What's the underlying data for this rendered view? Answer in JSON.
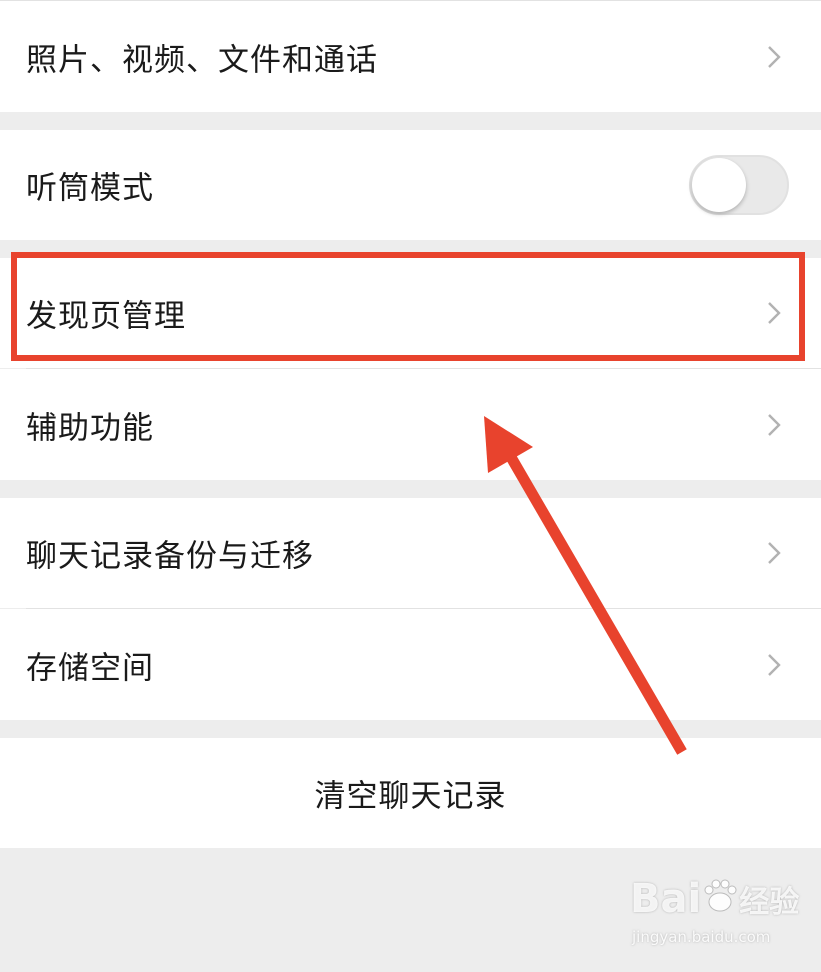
{
  "settings": {
    "items": [
      {
        "label": "照片、视频、文件和通话"
      },
      {
        "label": "听筒模式",
        "toggle_on": false
      },
      {
        "label": "发现页管理"
      },
      {
        "label": "辅助功能"
      },
      {
        "label": "聊天记录备份与迁移"
      },
      {
        "label": "存储空间"
      }
    ],
    "clear_label": "清空聊天记录"
  },
  "annotation": {
    "highlight_color": "#e8432d",
    "arrow_color": "#e8432d"
  },
  "watermark": {
    "brand": "Bai",
    "brand_suffix": "经验",
    "url": "jingyan.baidu.com"
  },
  "icons": {
    "chevron": "chevron-right-icon",
    "paw": "paw-icon"
  }
}
